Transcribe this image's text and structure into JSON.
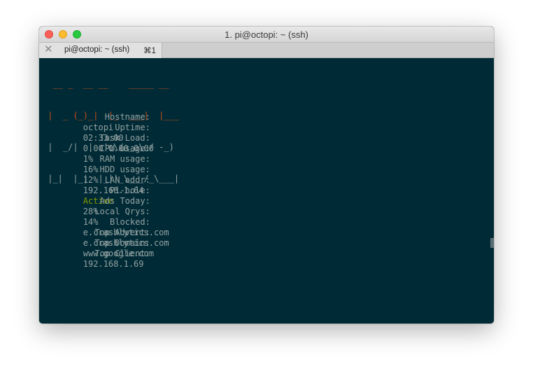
{
  "window": {
    "title": "1. pi@octopi: ~ (ssh)"
  },
  "tab": {
    "close_glyph": "✕",
    "label": "pi@octopi: ~ (ssh)",
    "shortcut": "⌘1"
  },
  "logo": {
    "lines": [
      "  __ _  __ __    _____ __",
      " |  _ (_)_|  |_  ___|  |___",
      " |  _/|  |  ' \\/ _ \\ / -_)",
      " |_|  |_|  |_||_\\___/_\\___|"
    ]
  },
  "stats": {
    "hostname": {
      "label": "Hostname:",
      "value": "octopi"
    },
    "uptime": {
      "label": "Uptime:",
      "value": "02:33:00"
    },
    "task_load": {
      "label": "Task Load:",
      "value": "0.00 0.00 0.00"
    },
    "cpu_usage": {
      "label": "CPU usage:",
      "value": "1%"
    },
    "ram_usage": {
      "label": "RAM usage:",
      "value": "16%"
    },
    "hdd_usage": {
      "label": "HDD usage:",
      "value": "12%"
    },
    "lan_addr": {
      "label": "LAN addr:",
      "value": "192.168.1.64"
    },
    "pi_hole": {
      "label": "Pi-hole:",
      "value": "Active",
      "color": "#859900"
    },
    "ads_today": {
      "label": "Ads Today:",
      "value": "28%"
    },
    "local_qrys": {
      "label": "Local Qrys:",
      "value": "14%"
    },
    "blocked": {
      "label": "Blocked:",
      "value": "e.crashlytics.com"
    },
    "top_advert": {
      "label": "Top Advert:",
      "value": "e.crashlytics.com"
    },
    "top_domain": {
      "label": "Top Domain:",
      "value": "www.google.com"
    },
    "top_client": {
      "label": "Top Client:",
      "value": "192.168.1.69"
    }
  },
  "colors": {
    "terminal_bg": "#002b36",
    "terminal_fg": "#93a1a1",
    "accent_red": "#cb4b16",
    "accent_blue": "#268bd2",
    "active_green": "#859900"
  }
}
